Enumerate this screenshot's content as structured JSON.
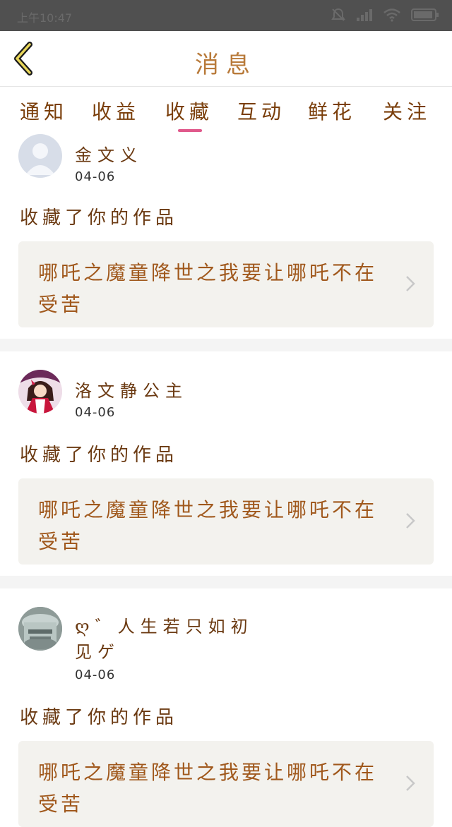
{
  "status_bar": {
    "time": "上午10:47"
  },
  "header": {
    "title": "消息"
  },
  "tabs": [
    {
      "label": "通知",
      "active": false
    },
    {
      "label": "收益",
      "active": false
    },
    {
      "label": "收藏",
      "active": true
    },
    {
      "label": "互动",
      "active": false
    },
    {
      "label": "鲜花",
      "active": false
    },
    {
      "label": "关注",
      "active": false
    }
  ],
  "colors": {
    "accent": "#e0598b",
    "text_brown": "#6b3a12",
    "card_bg": "#f3f2ee"
  },
  "messages": [
    {
      "user": "金文义",
      "date": "04-06",
      "action": "收藏了你的作品",
      "work_title": "哪吒之魔童降世之我要让哪吒不在受苦",
      "avatar": "default-avatar-icon"
    },
    {
      "user": "洛文静公主",
      "date": "04-06",
      "action": "收藏了你的作品",
      "work_title": "哪吒之魔童降世之我要让哪吒不在受苦",
      "avatar": "anime-girl-avatar"
    },
    {
      "user": "ღ゛人生若只如初见ゲ",
      "date": "04-06",
      "action": "收藏了你的作品",
      "work_title": "哪吒之魔童降世之我要让哪吒不在受苦",
      "avatar": "glass-avatar"
    }
  ]
}
